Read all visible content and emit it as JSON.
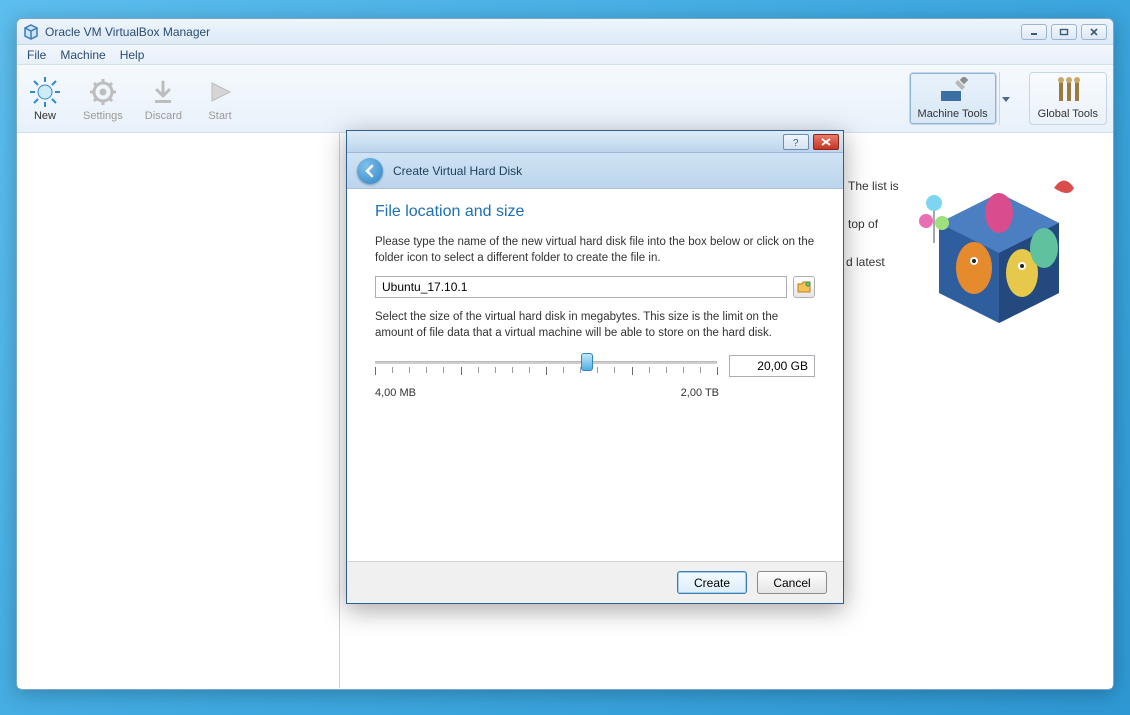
{
  "app": {
    "title": "Oracle VM VirtualBox Manager"
  },
  "menubar": {
    "file": "File",
    "machine": "Machine",
    "help": "Help"
  },
  "toolbar": {
    "new": "New",
    "settings": "Settings",
    "discard": "Discard",
    "start": "Start",
    "machine_tools": "Machine Tools",
    "global_tools": "Global Tools"
  },
  "details": {
    "line1": "The list is",
    "line2": "top of",
    "line3": "d latest"
  },
  "dialog": {
    "title": "Create Virtual Hard Disk",
    "heading": "File location and size",
    "loc_help": "Please type the name of the new virtual hard disk file into the box below or click on the folder icon to select a different folder to create the file in.",
    "filename": "Ubuntu_17.10.1",
    "size_help": "Select the size of the virtual hard disk in megabytes. This size is the limit on the amount of file data that a virtual machine will be able to store on the hard disk.",
    "size_value": "20,00 GB",
    "min_label": "4,00 MB",
    "max_label": "2,00 TB",
    "slider_percent": 62,
    "create": "Create",
    "cancel": "Cancel"
  }
}
